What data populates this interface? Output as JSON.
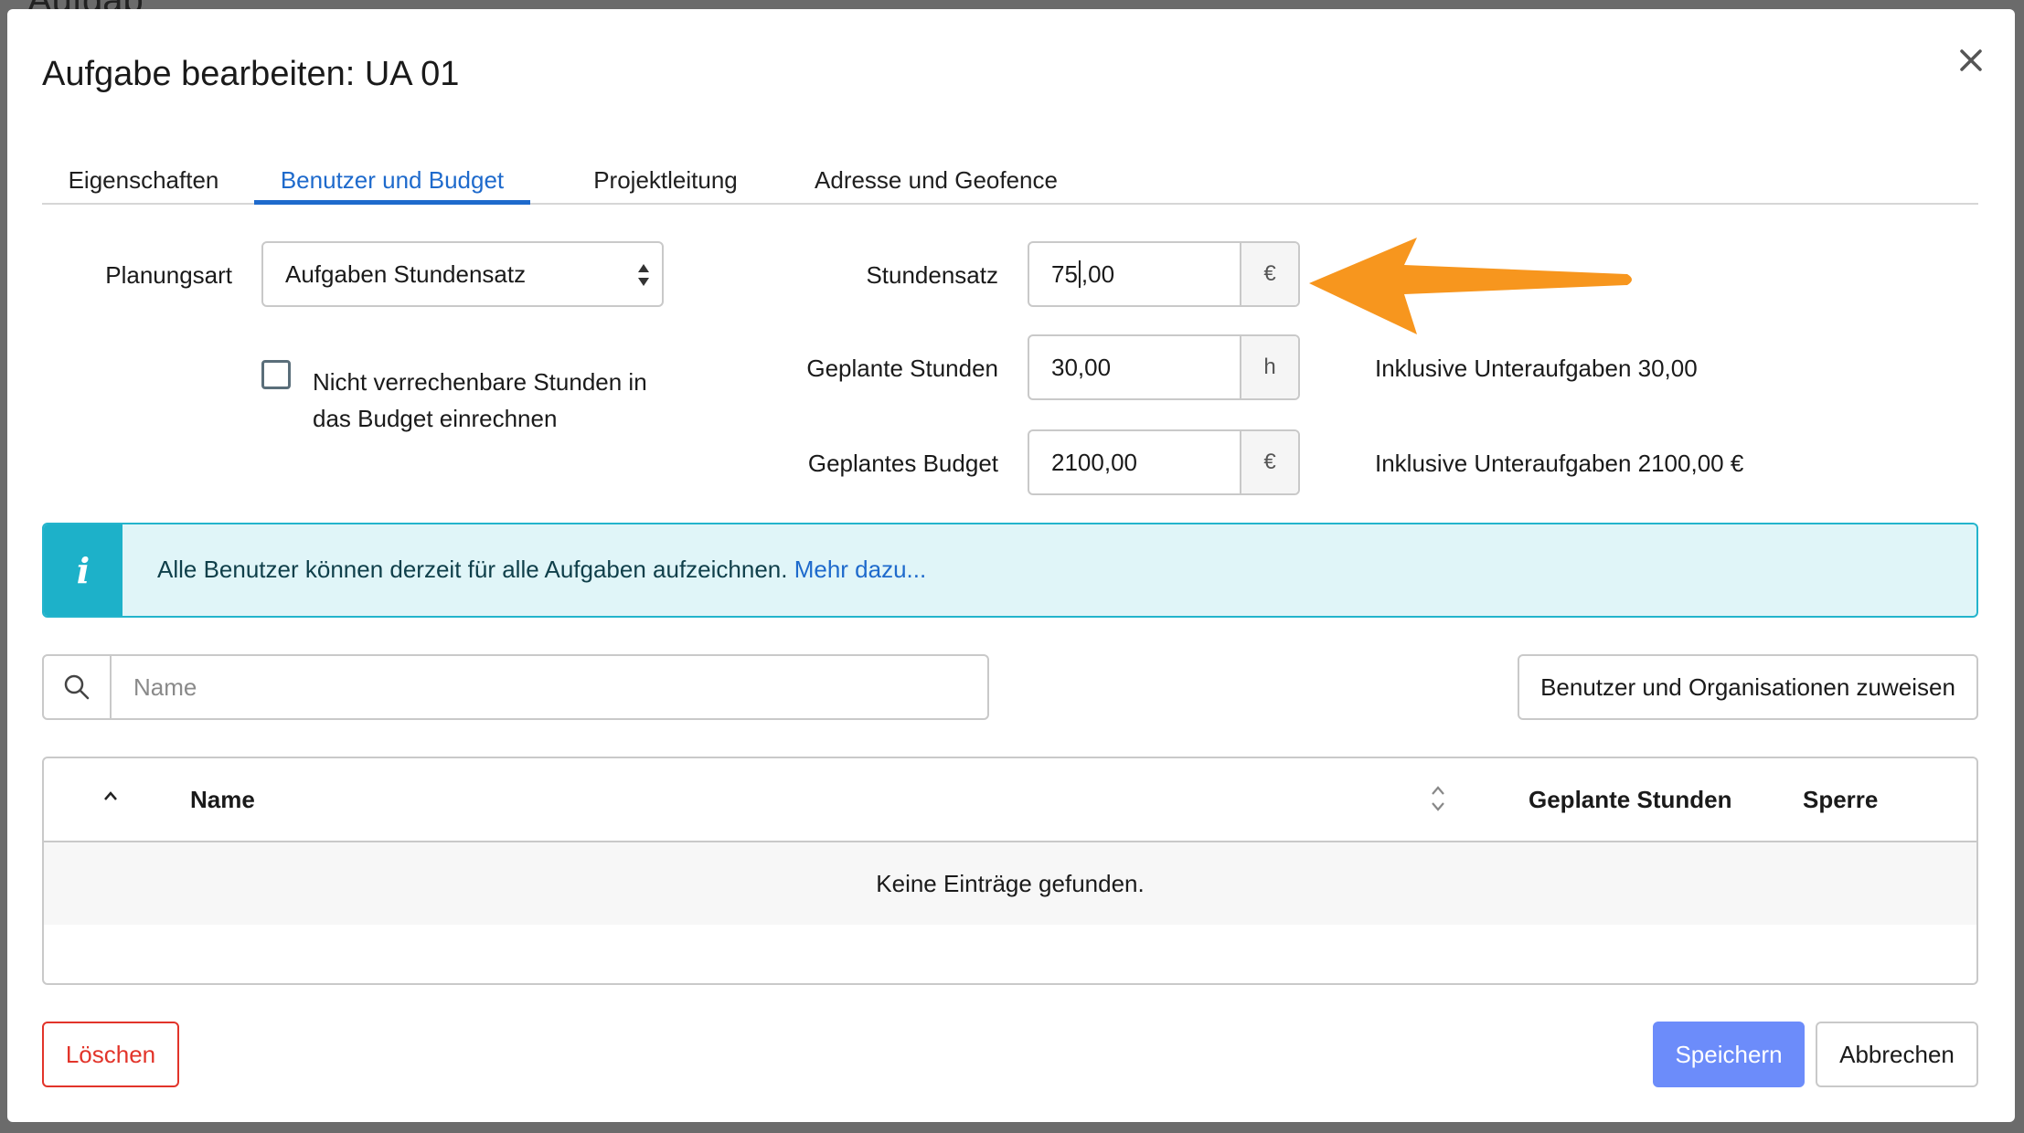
{
  "backdrop": {
    "text": "Aufgab"
  },
  "dialog": {
    "title": "Aufgabe bearbeiten: UA 01",
    "close_icon": "close-icon"
  },
  "tabs": [
    {
      "label": "Eigenschaften",
      "active": false
    },
    {
      "label": "Benutzer und Budget",
      "active": true
    },
    {
      "label": "Projektleitung",
      "active": false
    },
    {
      "label": "Adresse und Geofence",
      "active": false
    }
  ],
  "form": {
    "planungsart_label": "Planungsart",
    "planungsart_value": "Aufgaben Stundensatz",
    "checkbox_label": "Nicht verrechenbare Stunden in das Budget einrechnen",
    "checkbox_checked": false,
    "stundensatz_label": "Stundensatz",
    "stundensatz_value_before_cursor": "75",
    "stundensatz_value_after_cursor": ",00",
    "stundensatz_suffix": "€",
    "stunden_label": "Geplante Stunden",
    "stunden_value": "30,00",
    "stunden_suffix": "h",
    "stunden_inkl": "Inklusive Unteraufgaben 30,00",
    "budget_label": "Geplantes Budget",
    "budget_value": "2100,00",
    "budget_suffix": "€",
    "budget_inkl": "Inklusive Unteraufgaben 2100,00 €"
  },
  "info": {
    "icon": "info-icon",
    "text": "Alle Benutzer können derzeit für alle Aufgaben aufzeichnen.",
    "link": "Mehr dazu..."
  },
  "search": {
    "placeholder": "Name",
    "icon": "search-icon"
  },
  "assign_button": "Benutzer und Organisationen zuweisen",
  "table": {
    "columns": [
      "Name",
      "Geplante Stunden",
      "Sperre"
    ],
    "empty_text": "Keine Einträge gefunden."
  },
  "footer": {
    "delete_label": "Löschen",
    "save_label": "Speichern",
    "cancel_label": "Abbrechen"
  },
  "colors": {
    "accent": "#1e6acc",
    "info_bg": "#e0f5f8",
    "info_icon_bg": "#1db1c9",
    "delete": "#e2342a",
    "save": "#6c8cfa",
    "annotation_arrow": "#f7961e"
  }
}
